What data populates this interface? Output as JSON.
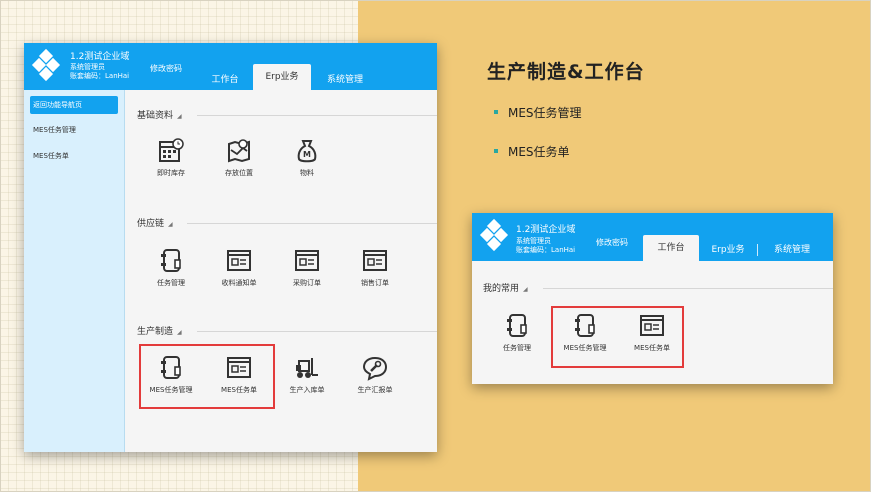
{
  "slide": {
    "title": "生产制造&工作台",
    "bullets": [
      "MES任务管理",
      "MES任务单"
    ]
  },
  "app_main": {
    "org": "1.2测试企业域",
    "user": "系统管理员",
    "account": "账套编码：LanHai",
    "change_password": "修改密码",
    "tabs": [
      {
        "label": "工作台",
        "active": false
      },
      {
        "label": "Erp业务",
        "active": true
      },
      {
        "label": "系统管理",
        "active": false
      }
    ],
    "sidebar": [
      "返回功能导航页",
      "MES任务管理",
      "MES任务单"
    ],
    "sections": [
      {
        "title": "基础资料",
        "items": [
          {
            "label": "即时库存",
            "icon": "calendar-icon"
          },
          {
            "label": "存放位置",
            "icon": "map-icon"
          },
          {
            "label": "物料",
            "icon": "money-bag-icon"
          }
        ]
      },
      {
        "title": "供应链",
        "items": [
          {
            "label": "任务管理",
            "icon": "notebook-icon"
          },
          {
            "label": "收料通知单",
            "icon": "form-window-icon"
          },
          {
            "label": "采购订单",
            "icon": "form-window-icon"
          },
          {
            "label": "销售订单",
            "icon": "form-window-icon"
          }
        ]
      },
      {
        "title": "生产制造",
        "items": [
          {
            "label": "MES任务管理",
            "icon": "notebook-icon"
          },
          {
            "label": "MES任务单",
            "icon": "form-window-icon"
          },
          {
            "label": "生产入库单",
            "icon": "forklift-icon"
          },
          {
            "label": "生产汇报单",
            "icon": "wrench-chat-icon"
          }
        ]
      }
    ]
  },
  "app_workbench": {
    "org": "1.2测试企业域",
    "user": "系统管理员",
    "account": "账套编码：LanHai",
    "change_password": "修改密码",
    "tabs": [
      {
        "label": "工作台",
        "active": true
      },
      {
        "label": "Erp业务",
        "active": false
      },
      {
        "label": "系统管理",
        "active": false
      }
    ],
    "section": {
      "title": "我的常用",
      "items": [
        {
          "label": "任务管理",
          "icon": "notebook-icon"
        },
        {
          "label": "MES任务管理",
          "icon": "notebook-icon"
        },
        {
          "label": "MES任务单",
          "icon": "form-window-icon"
        }
      ]
    }
  },
  "colors": {
    "header": "#12a2ef",
    "highlight": "#e33b3b",
    "accent_right": "#f0c978",
    "bullet": "#2aa7a0"
  }
}
